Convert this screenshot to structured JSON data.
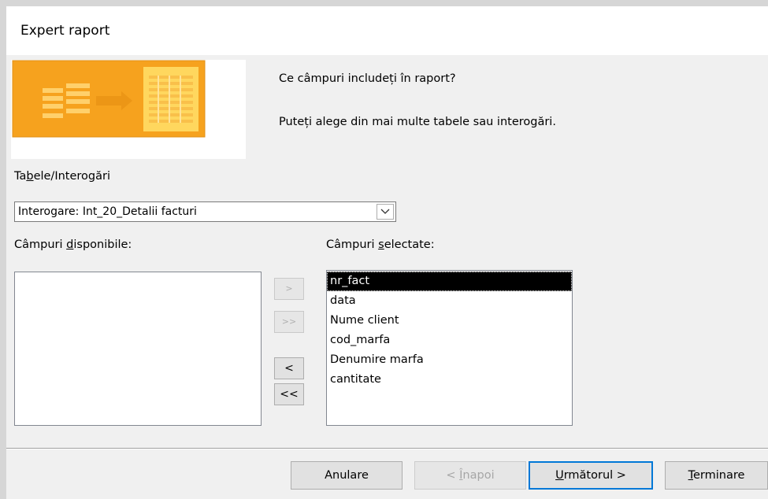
{
  "window": {
    "title": "Expert raport"
  },
  "wizard": {
    "question": "Ce câmpuri includeți în raport?",
    "hint": "Puteți alege din mai multe tabele sau interogări."
  },
  "source": {
    "label_pre": "Ta",
    "label_key": "b",
    "label_post": "ele/Interogări",
    "selected_value": "Interogare: Int_20_Detalii facturi"
  },
  "available": {
    "label_pre": "Câmpuri ",
    "label_key": "d",
    "label_post": "isponibile:",
    "items": []
  },
  "selected": {
    "label_pre": "Câmpuri ",
    "label_key": "s",
    "label_post": "electate:",
    "items": [
      "nr_fact",
      "data",
      "Nume client",
      "cod_marfa",
      "Denumire marfa",
      "cantitate"
    ],
    "selected_item": "nr_fact"
  },
  "move_buttons": {
    "add_one": ">",
    "add_all": ">>",
    "remove_one": "<",
    "remove_all": "<<"
  },
  "footer": {
    "cancel": "Anulare",
    "back_key": "Î",
    "back_pre": "< ",
    "back_post": "napoi",
    "next_key": "U",
    "next_post": "rmătorul >",
    "finish_key": "T",
    "finish_post": "erminare"
  },
  "colors": {
    "image_orange": "#f5a623",
    "image_yellow": "#ffd34d",
    "default_border": "#0078d7",
    "selection_bg": "#000000"
  }
}
